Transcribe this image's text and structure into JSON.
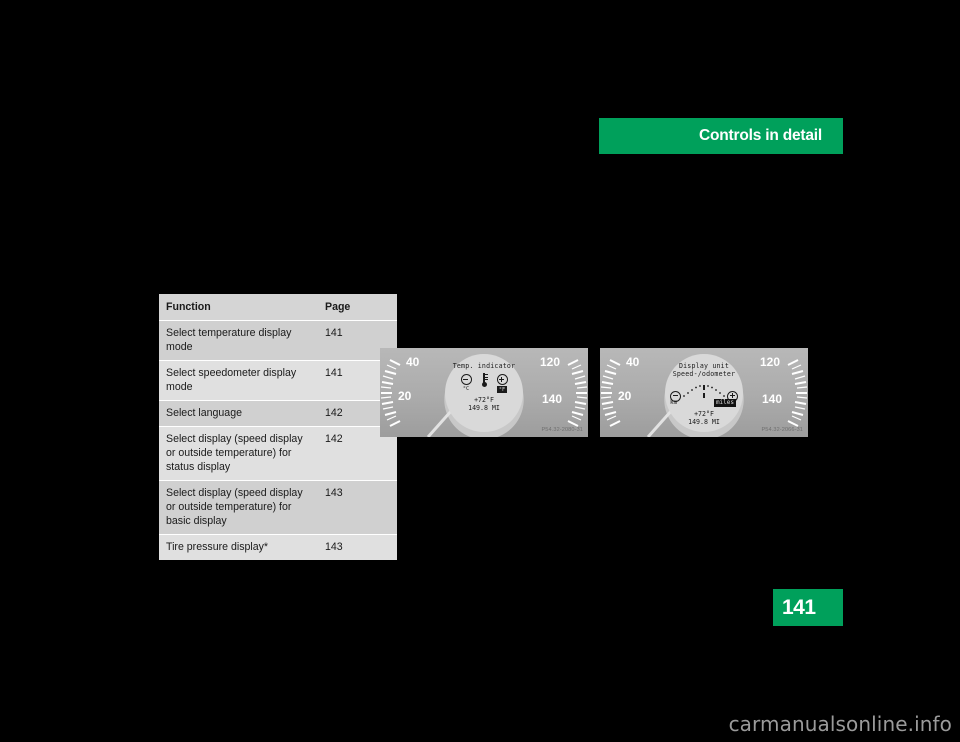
{
  "document": {
    "background_color": "#000000",
    "accent_color": "#00a05b",
    "page_number": "141",
    "watermark": "carmanualsonline.info"
  },
  "section_banner": {
    "title": "Controls in detail"
  },
  "table": {
    "columns": [
      "Function",
      "Page"
    ],
    "rows": [
      {
        "function": "Select temperature display mode",
        "page": "141"
      },
      {
        "function": "Select speedometer display mode",
        "page": "141"
      },
      {
        "function": "Select language",
        "page": "142"
      },
      {
        "function": "Select display (speed display or outside temperature) for status display",
        "page": "142"
      },
      {
        "function": "Select display (speed display or outside temperature) for basic display",
        "page": "143"
      },
      {
        "function": "Tire pressure display*",
        "page": "143"
      }
    ]
  },
  "figures": [
    {
      "id": "figure-temp",
      "caption": "P54.32-2080-31",
      "gauge_ticks_left": [
        "40",
        "20"
      ],
      "gauge_ticks_right": [
        "120",
        "140"
      ],
      "display": {
        "title": "Temp. indicator",
        "subtitle": "",
        "icons": [
          {
            "name": "minus-circle-icon",
            "label": "°C",
            "selected": false
          },
          {
            "name": "thermometer-icon",
            "label": "",
            "selected": false
          },
          {
            "name": "plus-circle-icon",
            "label": "°F",
            "selected": true
          }
        ],
        "readout_line1": "+72°F",
        "readout_line2": "149.8 MI"
      }
    },
    {
      "id": "figure-unit",
      "caption": "P54.32-2066-31",
      "gauge_ticks_left": [
        "40",
        "20"
      ],
      "gauge_ticks_right": [
        "120",
        "140"
      ],
      "display": {
        "title": "Display unit",
        "subtitle": "Speed-/odometer",
        "unit_left": "km",
        "unit_right": "miles",
        "unit_right_selected": true,
        "readout_line1": "+72°F",
        "readout_line2": "149.8 MI"
      }
    }
  ]
}
